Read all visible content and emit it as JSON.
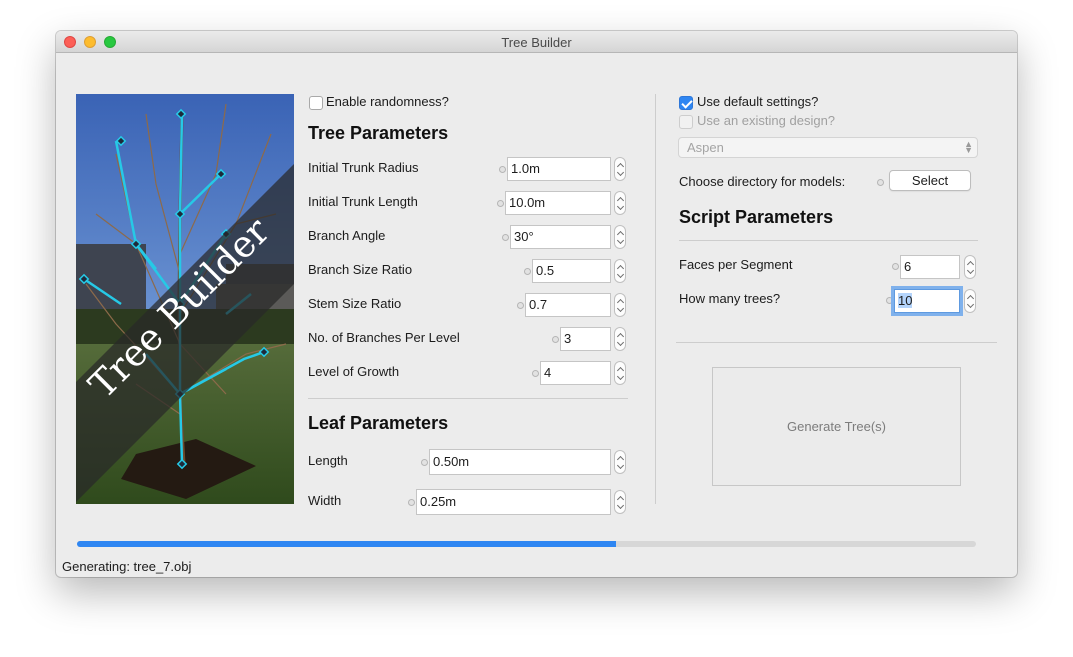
{
  "window": {
    "title": "Tree Builder"
  },
  "hero": {
    "overlay_text": "Tree Builder",
    "description_icon": "tree-photo-icon"
  },
  "left": {
    "enable_randomness": {
      "label": "Enable randomness?",
      "checked": false
    },
    "tree_parameters": {
      "heading": "Tree Parameters",
      "fields": [
        {
          "label": "Initial Trunk Radius",
          "value": "1.0m"
        },
        {
          "label": "Initial Trunk Length",
          "value": "10.0m"
        },
        {
          "label": "Branch Angle",
          "value": "30°"
        },
        {
          "label": "Branch Size Ratio",
          "value": "0.5"
        },
        {
          "label": "Stem Size Ratio",
          "value": "0.7"
        },
        {
          "label": "No. of Branches Per Level",
          "value": "3"
        },
        {
          "label": "Level of Growth",
          "value": "4"
        }
      ]
    },
    "leaf_parameters": {
      "heading": "Leaf Parameters",
      "fields": [
        {
          "label": "Length",
          "value": "0.50m"
        },
        {
          "label": "Width",
          "value": "0.25m"
        }
      ]
    }
  },
  "right": {
    "use_default": {
      "label": "Use default settings?",
      "checked": true
    },
    "use_existing": {
      "label": "Use an existing design?",
      "checked": false,
      "disabled": true
    },
    "design_select": {
      "value": "Aspen",
      "disabled": true
    },
    "directory": {
      "label": "Choose directory for models:",
      "button": "Select"
    },
    "script_parameters": {
      "heading": "Script Parameters",
      "fields": [
        {
          "label": "Faces per Segment",
          "value": "6"
        },
        {
          "label": "How many trees?",
          "value": "10"
        }
      ]
    },
    "generate_button": "Generate Tree(s)"
  },
  "progress": {
    "fraction": 0.6
  },
  "status": {
    "text": "Generating: tree_7.obj"
  },
  "colors": {
    "accent": "#2e86f2",
    "branch_overlay": "#26c9e6"
  }
}
